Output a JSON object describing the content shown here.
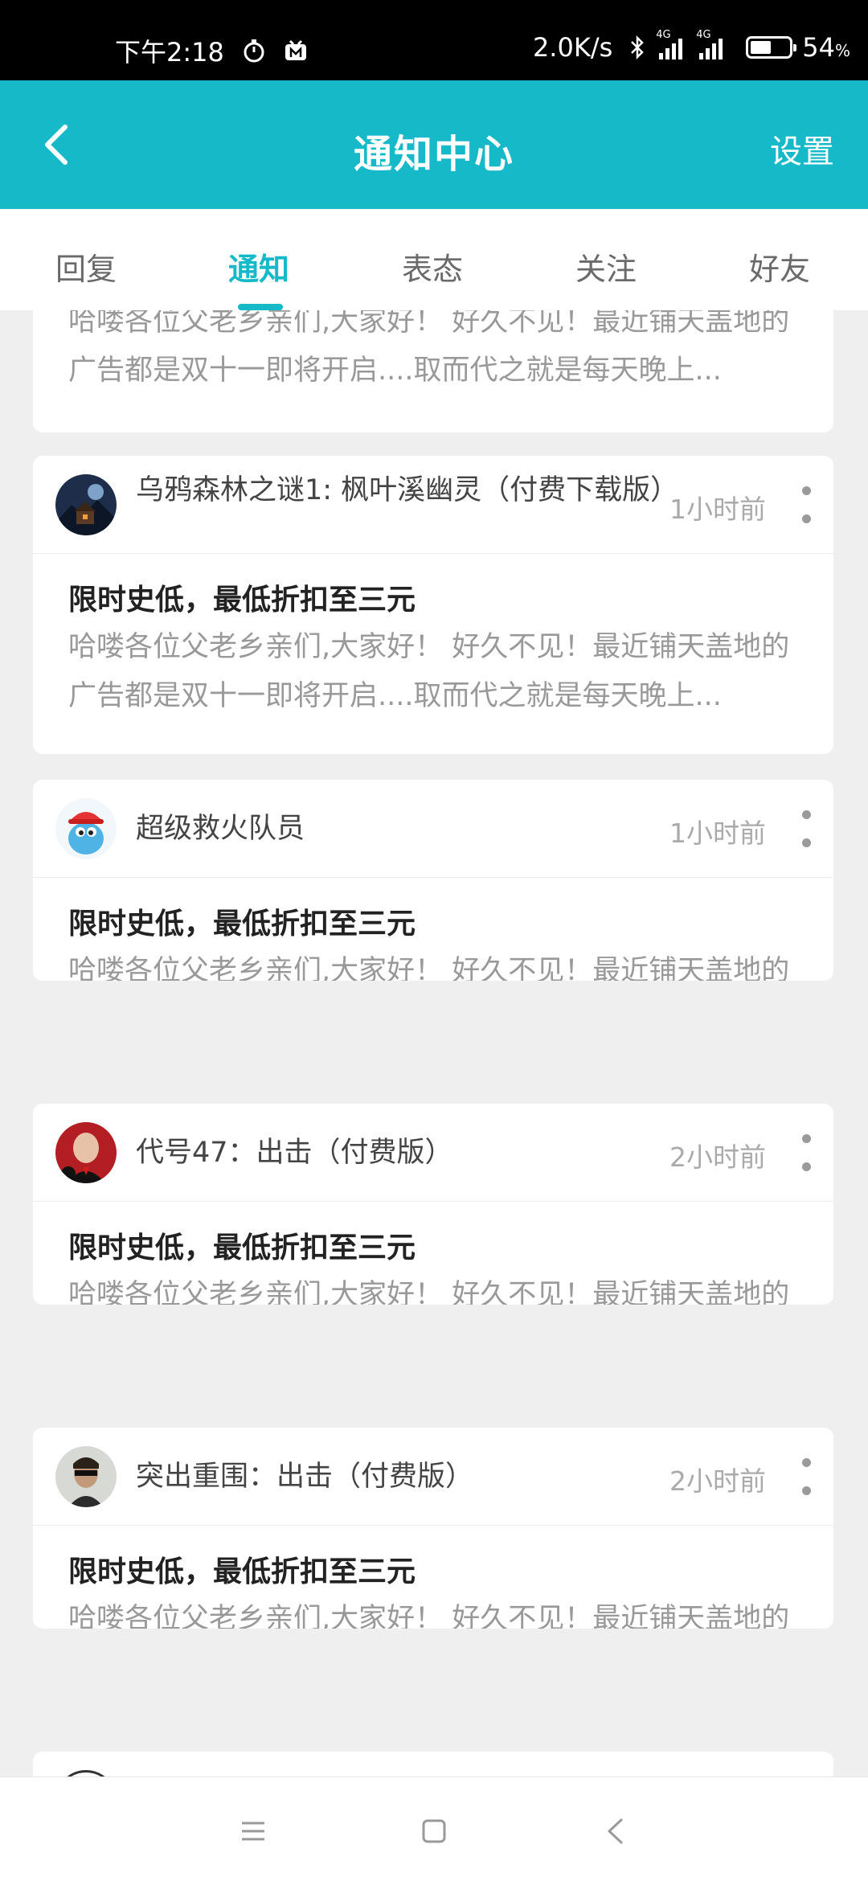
{
  "status_bar": {
    "time": "下午2:18",
    "net_speed": "2.0K/s",
    "signal_tag_1": "4G",
    "signal_tag_2": "4G",
    "battery_number": "54",
    "battery_unit": "%",
    "battery_level": 0.54
  },
  "header": {
    "title": "通知中心",
    "settings_label": "设置"
  },
  "tabs": [
    {
      "label": "回复",
      "active": false
    },
    {
      "label": "通知",
      "active": true
    },
    {
      "label": "表态",
      "active": false
    },
    {
      "label": "关注",
      "active": false
    },
    {
      "label": "好友",
      "active": false
    }
  ],
  "partial_card": {
    "desc": "哈喽各位父老乡亲们,大家好！ 好久不见！最近铺天盖地的广告都是双十一即将开启....取而代之就是每天晚上..."
  },
  "cards": [
    {
      "game": "乌鸦森林之谜1: 枫叶溪幽灵（付费下载版）",
      "time": "1小时前",
      "title": "限时史低，最低折扣至三元",
      "desc": "哈喽各位父老乡亲们,大家好！ 好久不见！最近铺天盖地的广告都是双十一即将开启....取而代之就是每天晚上..."
    },
    {
      "game": "超级救火队员",
      "time": "1小时前",
      "title": "限时史低，最低折扣至三元",
      "desc": "哈喽各位父老乡亲们,大家好！ 好久不见！最近铺天盖地的广告都是双十一即将开启....取而代之就是每天晚上..."
    },
    {
      "game": "代号47：出击（付费版）",
      "time": "2小时前",
      "title": "限时史低，最低折扣至三元",
      "desc": "哈喽各位父老乡亲们,大家好！ 好久不见！最近铺天盖地的广告都是双十一即将开启....取而代之就是每天晚上..."
    },
    {
      "game": "突出重围：出击（付费版）",
      "time": "2小时前",
      "title": "限时史低，最低折扣至三元",
      "desc": "哈喽各位父老乡亲们,大家好！ 好久不见！最近铺天盖地的广告都是双十一即将开启....取而代之就是每天晚上..."
    }
  ],
  "icons": {
    "back": "chevron-left-icon",
    "more": "more-vertical-icon",
    "nav_menu": "menu-icon",
    "nav_home": "home-square-icon",
    "nav_back": "back-triangle-icon"
  },
  "colors": {
    "accent": "#16b9c8",
    "background": "#efefef"
  }
}
